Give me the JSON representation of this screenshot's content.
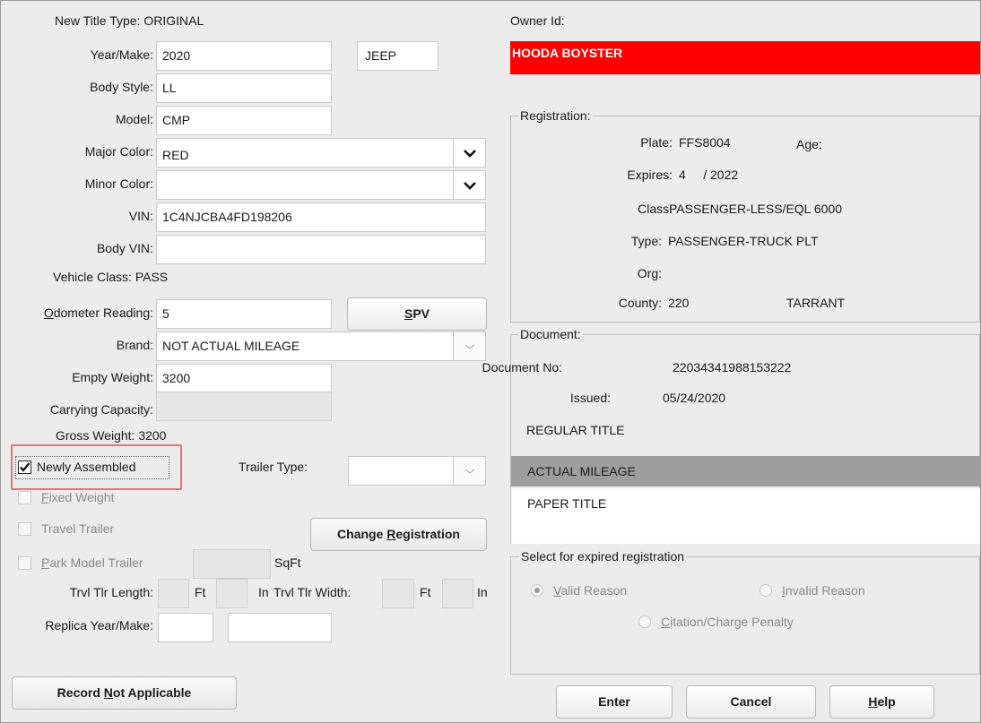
{
  "title_type": {
    "label": "New Title Type:",
    "value": "ORIGINAL"
  },
  "year_make": {
    "label": "Year/Make:",
    "year": "2020",
    "make": "JEEP"
  },
  "body_style": {
    "label": "Body Style:",
    "value": "LL"
  },
  "model": {
    "label": "Model:",
    "value": "CMP"
  },
  "major_color": {
    "label": "Major Color:",
    "value": "RED"
  },
  "minor_color": {
    "label": "Minor Color:",
    "value": ""
  },
  "vin": {
    "label": "VIN:",
    "value": "1C4NJCBA4FD198206"
  },
  "body_vin": {
    "label": "Body VIN:",
    "value": ""
  },
  "vehicle_class": {
    "label": "Vehicle Class:",
    "value": "PASS"
  },
  "odometer": {
    "label_prefix": "O",
    "label_rest": "dometer Reading:",
    "value": "5"
  },
  "spv_button": {
    "prefix": "",
    "underline": "S",
    "rest": "PV"
  },
  "brand": {
    "label": "Brand:",
    "value": "NOT ACTUAL MILEAGE"
  },
  "empty_weight": {
    "label": "Empty Weight:",
    "value": "3200"
  },
  "carrying_capacity": {
    "label": "Carrying Capacity:",
    "value": ""
  },
  "gross_weight": {
    "label": "Gross Weight:",
    "value": "3200"
  },
  "newly_assembled": {
    "label": "Newly Assembled",
    "checked": true
  },
  "trailer_type": {
    "label": "Trailer Type:",
    "value": ""
  },
  "fixed_weight": {
    "underline": "F",
    "rest": "ixed Weight"
  },
  "travel_trailer": {
    "label": "Travel Trailer"
  },
  "change_registration_button": {
    "prefix": "Change ",
    "underline": "R",
    "rest": "egistration"
  },
  "park_model_trailer": {
    "underline": "P",
    "rest": "ark Model Trailer",
    "unit": "SqFt"
  },
  "trvl_tlr_length": {
    "label": "Trvl Tlr Length:",
    "ft": "Ft",
    "in": "In"
  },
  "trvl_tlr_width": {
    "label": "Trvl Tlr Width:",
    "ft": "Ft",
    "in": "In"
  },
  "replica": {
    "label": "Replica Year/Make:"
  },
  "record_na_button": {
    "prefix": "Record ",
    "underline": "N",
    "rest": "ot Applicable"
  },
  "owner": {
    "label": "Owner Id:",
    "name": "HOODA BOYSTER"
  },
  "registration": {
    "title": "Registration:",
    "plate_label": "Plate:",
    "plate": "FFS8004",
    "age_label": "Age:",
    "expires_label": "Expires:",
    "expires": "4     / 2022",
    "class_label": "Class:",
    "class": "PASSENGER-LESS/EQL 6000",
    "type_label": "Type:",
    "type": "PASSENGER-TRUCK PLT",
    "org_label": "Org:",
    "county_label": "County:",
    "county_code": "220",
    "county_name": "TARRANT"
  },
  "document": {
    "title": "Document:",
    "doc_no_label": "Document No:",
    "doc_no": "22034341988153222",
    "issued_label": "Issued:",
    "issued": "05/24/2020",
    "items": [
      "REGULAR TITLE",
      "ACTUAL MILEAGE",
      "PAPER TITLE"
    ]
  },
  "expired_reg": {
    "title": "Select for expired registration",
    "valid": {
      "underline": "V",
      "rest": "alid Reason"
    },
    "invalid": {
      "underline": "I",
      "rest": "nvalid Reason"
    },
    "citation": {
      "underline": "C",
      "rest": "itation/Charge Penalty"
    }
  },
  "bottom_buttons": {
    "enter": "Enter",
    "cancel": "Cancel",
    "help": {
      "underline": "H",
      "rest": "elp"
    }
  },
  "colors": {
    "owner_bar": "#ff0000",
    "selected_row": "#9e9e9e",
    "highlight_box": "#e57373"
  }
}
